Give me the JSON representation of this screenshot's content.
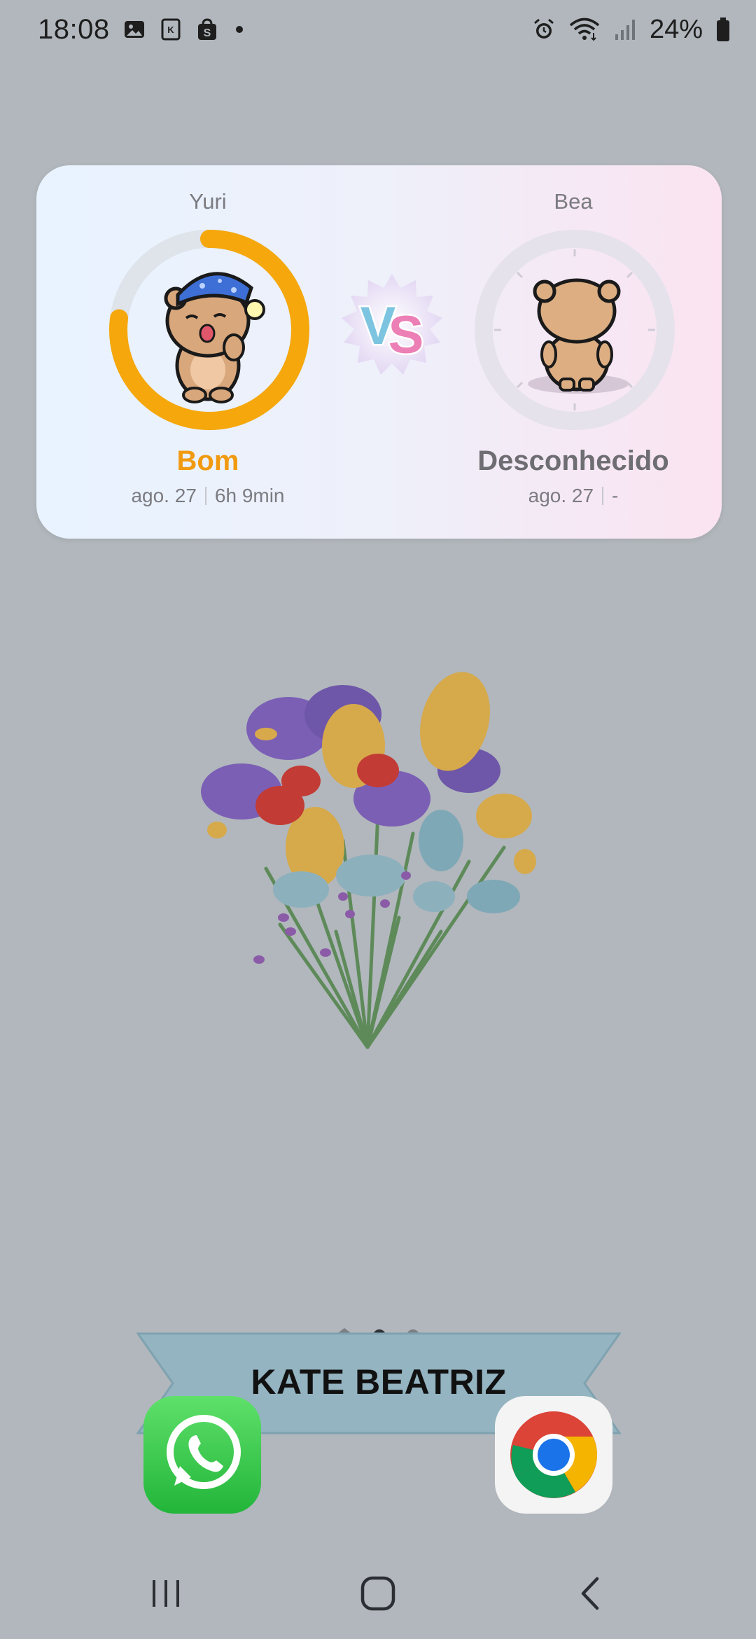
{
  "status_bar": {
    "time": "18:08",
    "battery": "24%",
    "left_icons": [
      "gallery-icon",
      "k-app-icon",
      "shopee-icon",
      "notification-dot"
    ],
    "right_icons": [
      "alarm-icon",
      "wifi-icon",
      "signal-icon",
      "battery-icon"
    ]
  },
  "sleep_widget": {
    "left": {
      "name": "Yuri",
      "quality": "Bom",
      "date": "ago. 27",
      "duration": "6h 9min",
      "ring_progress": 0.77
    },
    "right": {
      "name": "Bea",
      "quality": "Desconhecido",
      "date": "ago. 27",
      "duration": "-",
      "ring_progress": 0
    },
    "vs_label": "VS",
    "colors": {
      "good": "#f19a10",
      "ring_track": "#e0e4ec",
      "vs_v": "#7cc4e0",
      "vs_s": "#ec7fb5"
    }
  },
  "home": {
    "page_indicator": {
      "count": 2,
      "active": 0
    },
    "banner_text": "KATE BEATRIZ"
  },
  "dock": {
    "apps": [
      {
        "name": "WhatsApp",
        "icon": "whatsapp-icon"
      },
      {
        "name": "Chrome",
        "icon": "chrome-icon"
      }
    ]
  },
  "nav_bar": {
    "buttons": [
      "recents-icon",
      "home-icon",
      "back-icon"
    ]
  }
}
